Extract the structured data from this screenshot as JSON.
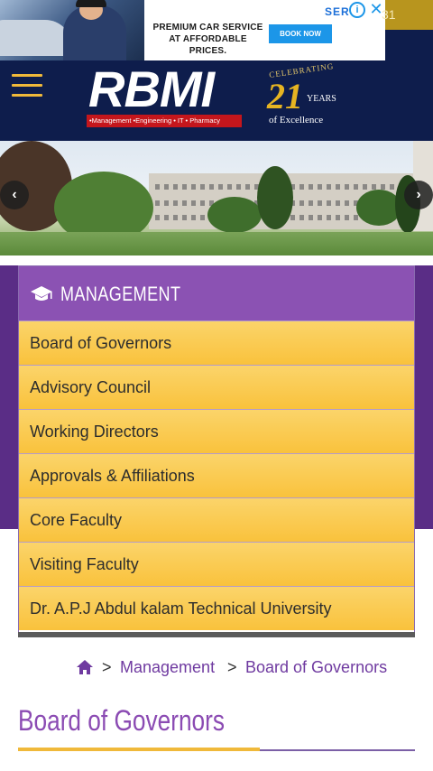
{
  "ad": {
    "text_line1": "PREMIUM CAR SERVICE",
    "text_line2": "AT AFFORDABLE PRICES.",
    "cta": "BOOK NOW",
    "brand_fragment": "SER",
    "info_icon": "info-icon",
    "close_icon": "close-icon",
    "corner_text": "31"
  },
  "header": {
    "menu_icon": "hamburger-icon",
    "logo_text": "RBMI",
    "logo_tagline": "•Management •Engineering • IT • Pharmacy",
    "celebrating": "CELEBRATING",
    "years_number": "21",
    "years_label": "YEARS",
    "excellence": "of Excellence"
  },
  "slider": {
    "prev_icon": "chevron-left-icon",
    "next_icon": "chevron-right-icon"
  },
  "menu": {
    "icon": "graduation-cap-icon",
    "title": "MANAGEMENT",
    "items": [
      {
        "label": "Board of Governors"
      },
      {
        "label": "Advisory Council"
      },
      {
        "label": "Working Directors"
      },
      {
        "label": "Approvals & Affiliations"
      },
      {
        "label": "Core Faculty"
      },
      {
        "label": "Visiting Faculty"
      },
      {
        "label": "Dr. A.P.J Abdul kalam Technical University"
      }
    ]
  },
  "breadcrumb": {
    "home_icon": "home-icon",
    "separator": ">",
    "items": [
      "Management",
      "Board of Governors"
    ]
  },
  "page": {
    "title": "Board of Governors"
  },
  "colors": {
    "navy": "#0e1d4c",
    "purple": "#5a2d86",
    "menu_header": "#8b52b3",
    "menu_item": "#f9c23c",
    "accent_gold": "#f0b93a",
    "link_purple": "#6f3aa0"
  }
}
